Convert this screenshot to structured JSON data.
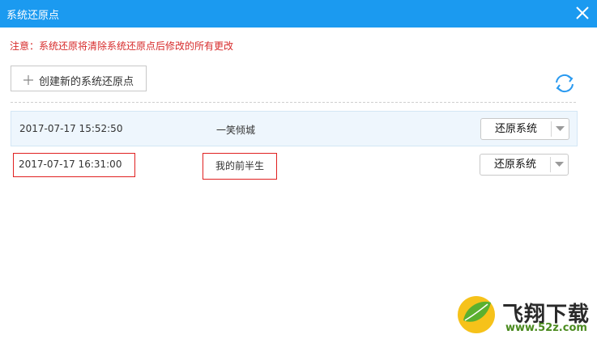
{
  "window": {
    "title": "系统还原点",
    "close_icon": "close-icon"
  },
  "warning": "注意：系统还原将清除系统还原点后修改的所有更改",
  "toolbar": {
    "create_label": "创建新的系统还原点",
    "create_icon": "plus-icon",
    "refresh_icon": "refresh-icon"
  },
  "restore_points": [
    {
      "date": "2017-07-17 15:52:50",
      "name": "一笑倾城",
      "action_label": "还原系统",
      "highlighted": true
    },
    {
      "date": "2017-07-17 16:31:00",
      "name": "我的前半生",
      "action_label": "还原系统",
      "highlighted": false
    }
  ],
  "watermark": {
    "brand": "飞翔下载",
    "url": "www.52z.com"
  },
  "colors": {
    "titlebar": "#1b9af0",
    "warning": "#d72b2b",
    "annotation": "#e02020",
    "row_highlight": "#eef6fd"
  }
}
